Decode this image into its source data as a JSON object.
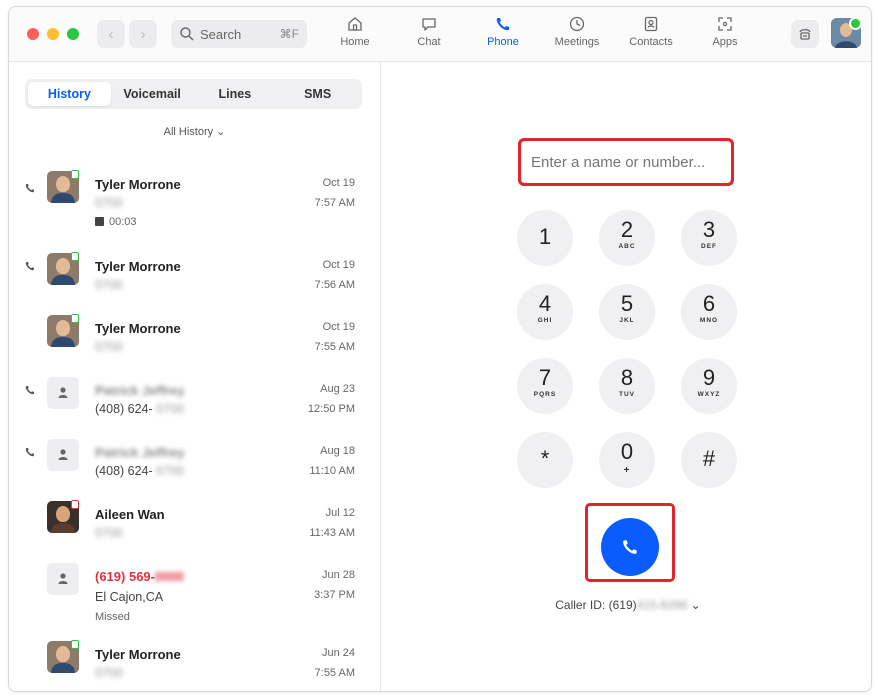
{
  "toolbar": {
    "search_label": "Search",
    "search_shortcut": "⌘F",
    "tabs": [
      {
        "label": "Home",
        "icon": "home-icon"
      },
      {
        "label": "Chat",
        "icon": "chat-icon"
      },
      {
        "label": "Phone",
        "icon": "phone-icon"
      },
      {
        "label": "Meetings",
        "icon": "clock-icon"
      },
      {
        "label": "Contacts",
        "icon": "contacts-icon"
      },
      {
        "label": "Apps",
        "icon": "apps-icon"
      }
    ],
    "active_tab": "Phone"
  },
  "left_panel": {
    "segments": [
      "History",
      "Voicemail",
      "Lines",
      "SMS"
    ],
    "active_segment": "History",
    "filter_label": "All History ⌄",
    "history": [
      {
        "name": "Tyler Morrone",
        "sub": "0700",
        "extra": "00:03",
        "date": "Oct 19",
        "time": "7:57 AM"
      },
      {
        "name": "Tyler Morrone",
        "sub": "0700",
        "date": "Oct 19",
        "time": "7:56 AM"
      },
      {
        "name": "Tyler Morrone",
        "sub": "0700",
        "date": "Oct 19",
        "time": "7:55 AM"
      },
      {
        "name": "Patrick Jeffrey",
        "sub": "(408) 624-",
        "sub_blur": "0700",
        "date": "Aug 23",
        "time": "12:50 PM"
      },
      {
        "name": "Patrick Jeffrey",
        "sub": "(408) 624-",
        "sub_blur": "0700",
        "date": "Aug 18",
        "time": "11:10 AM"
      },
      {
        "name": "Aileen Wan",
        "sub": "0700",
        "date": "Jul 12",
        "time": "11:43 AM"
      },
      {
        "name": "(619) 569-",
        "name_blur": "0000",
        "sub": "El Cajon,CA",
        "extra": "Missed",
        "date": "Jun 28",
        "time": "3:37 PM"
      },
      {
        "name": "Tyler Morrone",
        "sub": "0700",
        "date": "Jun 24",
        "time": "7:55 AM"
      }
    ]
  },
  "dialer": {
    "placeholder": "Enter a name or number...",
    "keys": [
      {
        "digit": "1",
        "letters": ""
      },
      {
        "digit": "2",
        "letters": "ABC"
      },
      {
        "digit": "3",
        "letters": "DEF"
      },
      {
        "digit": "4",
        "letters": "GHI"
      },
      {
        "digit": "5",
        "letters": "JKL"
      },
      {
        "digit": "6",
        "letters": "MNO"
      },
      {
        "digit": "7",
        "letters": "PQRS"
      },
      {
        "digit": "8",
        "letters": "TUV"
      },
      {
        "digit": "9",
        "letters": "WXYZ"
      },
      {
        "digit": "*",
        "letters": ""
      },
      {
        "digit": "0",
        "letters": "+"
      },
      {
        "digit": "#",
        "letters": ""
      }
    ],
    "caller_id_label": "Caller ID: (619)",
    "caller_id_blur": "415-8288",
    "caller_id_caret": "⌄"
  },
  "colors": {
    "accent": "#0b5cff",
    "missed": "#e0333e",
    "highlight": "#e0262b",
    "presence": "#28c840"
  }
}
